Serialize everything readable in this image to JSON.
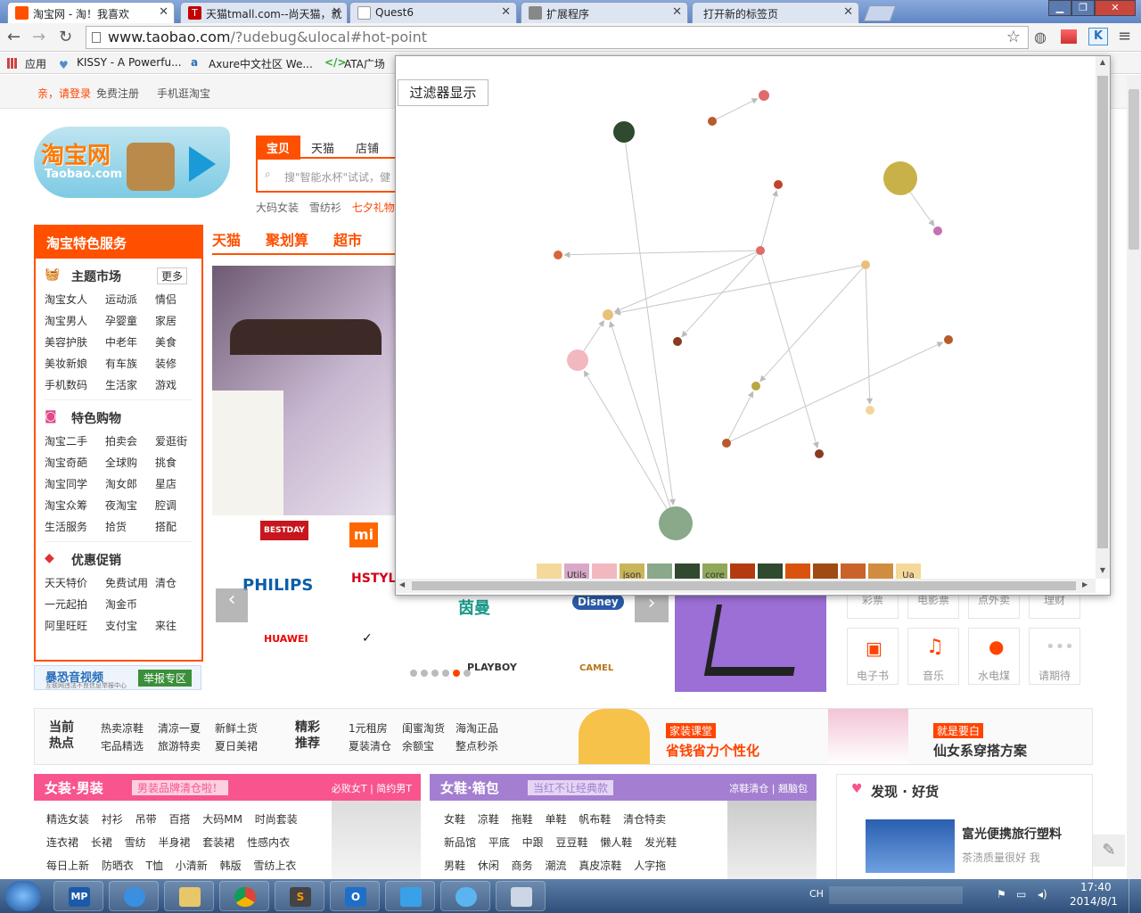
{
  "browser": {
    "tabs": [
      {
        "title": "淘宝网 - 淘！我喜欢",
        "icon": "taobao-icon",
        "color": "#ff5000",
        "active": true
      },
      {
        "title": "天猫tmall.com--尚天猫，就",
        "icon": "tmall-icon",
        "color": "#c40000"
      },
      {
        "title": "Quest6",
        "icon": "page-icon",
        "color": "#ffffff"
      },
      {
        "title": "扩展程序",
        "icon": "puzzle-icon",
        "color": "#888888"
      },
      {
        "title": "打开新的标签页",
        "icon": "",
        "color": ""
      }
    ],
    "url_host": "www.taobao.com",
    "url_path": "/?udebug&ulocal#hot-point",
    "bookmarks": [
      "应用",
      "KISSY - A Powerfu...",
      "Axure中文社区 We...",
      "ATA广场"
    ]
  },
  "taobao": {
    "login": "亲，请登录",
    "register": "免费注册",
    "mobile": "手机逛淘宝",
    "logo_text": "淘宝网",
    "logo_sub": "Taobao.com",
    "search_tabs": [
      "宝贝",
      "天猫",
      "店铺"
    ],
    "search_placeholder": "搜\"智能水杯\"试试，健",
    "hot_words": [
      "大码女装",
      "雪纺衫",
      "七夕礼物"
    ],
    "services_title": "淘宝特色服务",
    "groups": [
      {
        "title": "主题市场",
        "more": "更多",
        "items": [
          "淘宝女人",
          "运动派",
          "情侣",
          "淘宝男人",
          "孕婴童",
          "家居",
          "美容护肤",
          "中老年",
          "美食",
          "美妆新娘",
          "有车族",
          "装修",
          "手机数码",
          "生活家",
          "游戏"
        ]
      },
      {
        "title": "特色购物",
        "items": [
          "淘宝二手",
          "拍卖会",
          "爱逛街",
          "淘宝奇葩",
          "全球购",
          "挑食",
          "淘宝同学",
          "淘女郎",
          "星店",
          "淘宝众筹",
          "夜淘宝",
          "腔调",
          "生活服务",
          "拾货",
          "搭配"
        ]
      },
      {
        "title": "优惠促销",
        "items": [
          "天天特价",
          "免费试用",
          "清仓",
          "一元起拍",
          "淘金币",
          "",
          "阿里旺旺",
          "支付宝",
          "来往"
        ]
      }
    ],
    "report": "暴恐音视频",
    "report_sub": "互联网违法不良信息举报中心",
    "report_btn": "举报专区",
    "cat_nav": [
      "天猫",
      "聚划算",
      "超市"
    ],
    "brands": [
      "BESTDAY",
      "PHILIPS",
      "HSTYLE 韩都衣舍",
      "茵曼",
      "Disney",
      "HUAWEI",
      "NIKE",
      "PLAYBOY",
      "CAMEL"
    ],
    "grid_items": [
      "彩票",
      "电影票",
      "点外卖",
      "理财",
      "电子书",
      "音乐",
      "水电煤",
      "请期待"
    ],
    "hot": {
      "label1": "当前热点",
      "words1": [
        "热卖凉鞋",
        "清凉一夏",
        "新鲜土货",
        "宅品精选",
        "旅游特卖",
        "夏日美裙"
      ],
      "label2": "精彩推荐",
      "words2": [
        "1元租房",
        "闺蜜淘货",
        "海淘正品",
        "夏装清仓",
        "余额宝",
        "整点秒杀"
      ],
      "promo1_tag": "家装课堂",
      "promo1": "省钱省力个性化",
      "promo2_tag": "就是要白",
      "promo2": "仙女系穿搭方案"
    },
    "sections": [
      {
        "title": "女装·男装",
        "tag": "男装品牌清仓啦！",
        "right": "必败女T | 简约男T",
        "color": "#f8558f",
        "rows": [
          "精选女装  衬衫  吊带  百搭  大码MM  时尚套装",
          "连衣裙  长裙  雪纺  半身裙  套装裙  性感内衣",
          "每日上新  防晒衣  T恤  小清新  韩版  雪纺上衣"
        ]
      },
      {
        "title": "女鞋·箱包",
        "tag": "当红不让经典款",
        "right": "凉鞋清仓 | 翘脑包",
        "color": "#a47fd1",
        "rows": [
          "女鞋  凉鞋  拖鞋  单鞋  帆布鞋  清仓特卖",
          "新品馆  平底  中跟  豆豆鞋  懒人鞋  发光鞋",
          "男鞋  休闲  商务  潮流  真皮凉鞋  人字拖"
        ]
      }
    ],
    "discover_title": "发现 · 好货",
    "discover_item": "富光便携旅行塑料",
    "discover_quote": "茶渍质量很好 我"
  },
  "popup": {
    "filter_button": "过滤器显示",
    "legend": [
      {
        "label": "",
        "color": "#f5d99b"
      },
      {
        "label": "Utils",
        "color": "#d9a7c7"
      },
      {
        "label": "",
        "color": "#f2b8c0"
      },
      {
        "label": "json",
        "color": "#c9b45a"
      },
      {
        "label": "",
        "color": "#8aa88a"
      },
      {
        "label": "",
        "color": "#2f4a2f"
      },
      {
        "label": "core",
        "color": "#8fa85a"
      },
      {
        "label": "",
        "color": "#b33b0f"
      },
      {
        "label": "",
        "color": "#2f4a2f"
      },
      {
        "label": "",
        "color": "#d9530f"
      },
      {
        "label": "",
        "color": "#a04a14"
      },
      {
        "label": "",
        "color": "#c9632a"
      },
      {
        "label": "",
        "color": "#d18d3f"
      },
      {
        "label": "Ua",
        "color": "#f5d99b"
      }
    ],
    "nodes": [
      {
        "id": "n1",
        "r": 6,
        "color": "#e06b6b"
      },
      {
        "id": "n2",
        "r": 5,
        "color": "#b85a2a"
      },
      {
        "id": "n3",
        "r": 12,
        "color": "#2f4a2f"
      },
      {
        "id": "n4",
        "r": 19,
        "color": "#c9b14a"
      },
      {
        "id": "n5",
        "r": 5,
        "color": "#c76fb0"
      },
      {
        "id": "n6",
        "r": 5,
        "color": "#c0442a"
      },
      {
        "id": "n7",
        "r": 5,
        "color": "#e06b6b"
      },
      {
        "id": "n8",
        "r": 5,
        "color": "#d9643a"
      },
      {
        "id": "n9",
        "r": 5,
        "color": "#e8c07a"
      },
      {
        "id": "n10",
        "r": 6,
        "color": "#e8c07a"
      },
      {
        "id": "n11",
        "r": 12,
        "color": "#f2b8c0"
      },
      {
        "id": "n12",
        "r": 5,
        "color": "#8a3a1f"
      },
      {
        "id": "n13",
        "r": 5,
        "color": "#b85a2a"
      },
      {
        "id": "n14",
        "r": 5,
        "color": "#b8a840"
      },
      {
        "id": "n15",
        "r": 5,
        "color": "#f2d59b"
      },
      {
        "id": "n16",
        "r": 5,
        "color": "#b85a2a"
      },
      {
        "id": "n17",
        "r": 5,
        "color": "#8a3a1f"
      },
      {
        "id": "n18",
        "r": 19,
        "color": "#8aa88a"
      }
    ],
    "links": [
      [
        "n2",
        "n1"
      ],
      [
        "n4",
        "n5"
      ],
      [
        "n3",
        "n18"
      ],
      [
        "n7",
        "n6"
      ],
      [
        "n7",
        "n8"
      ],
      [
        "n7",
        "n10"
      ],
      [
        "n7",
        "n12"
      ],
      [
        "n7",
        "n17"
      ],
      [
        "n9",
        "n10"
      ],
      [
        "n9",
        "n14"
      ],
      [
        "n9",
        "n15"
      ],
      [
        "n16",
        "n14"
      ],
      [
        "n16",
        "n13"
      ],
      [
        "n11",
        "n10"
      ],
      [
        "n18",
        "n11"
      ],
      [
        "n18",
        "n10"
      ]
    ]
  },
  "taskbar": {
    "apps": [
      "MP",
      "IE",
      "Explorer",
      "Chrome",
      "Sublime",
      "Outlook",
      "QQ",
      "Fish",
      "Calc"
    ],
    "ime": "CH",
    "time": "17:40",
    "date": "2014/8/1"
  }
}
